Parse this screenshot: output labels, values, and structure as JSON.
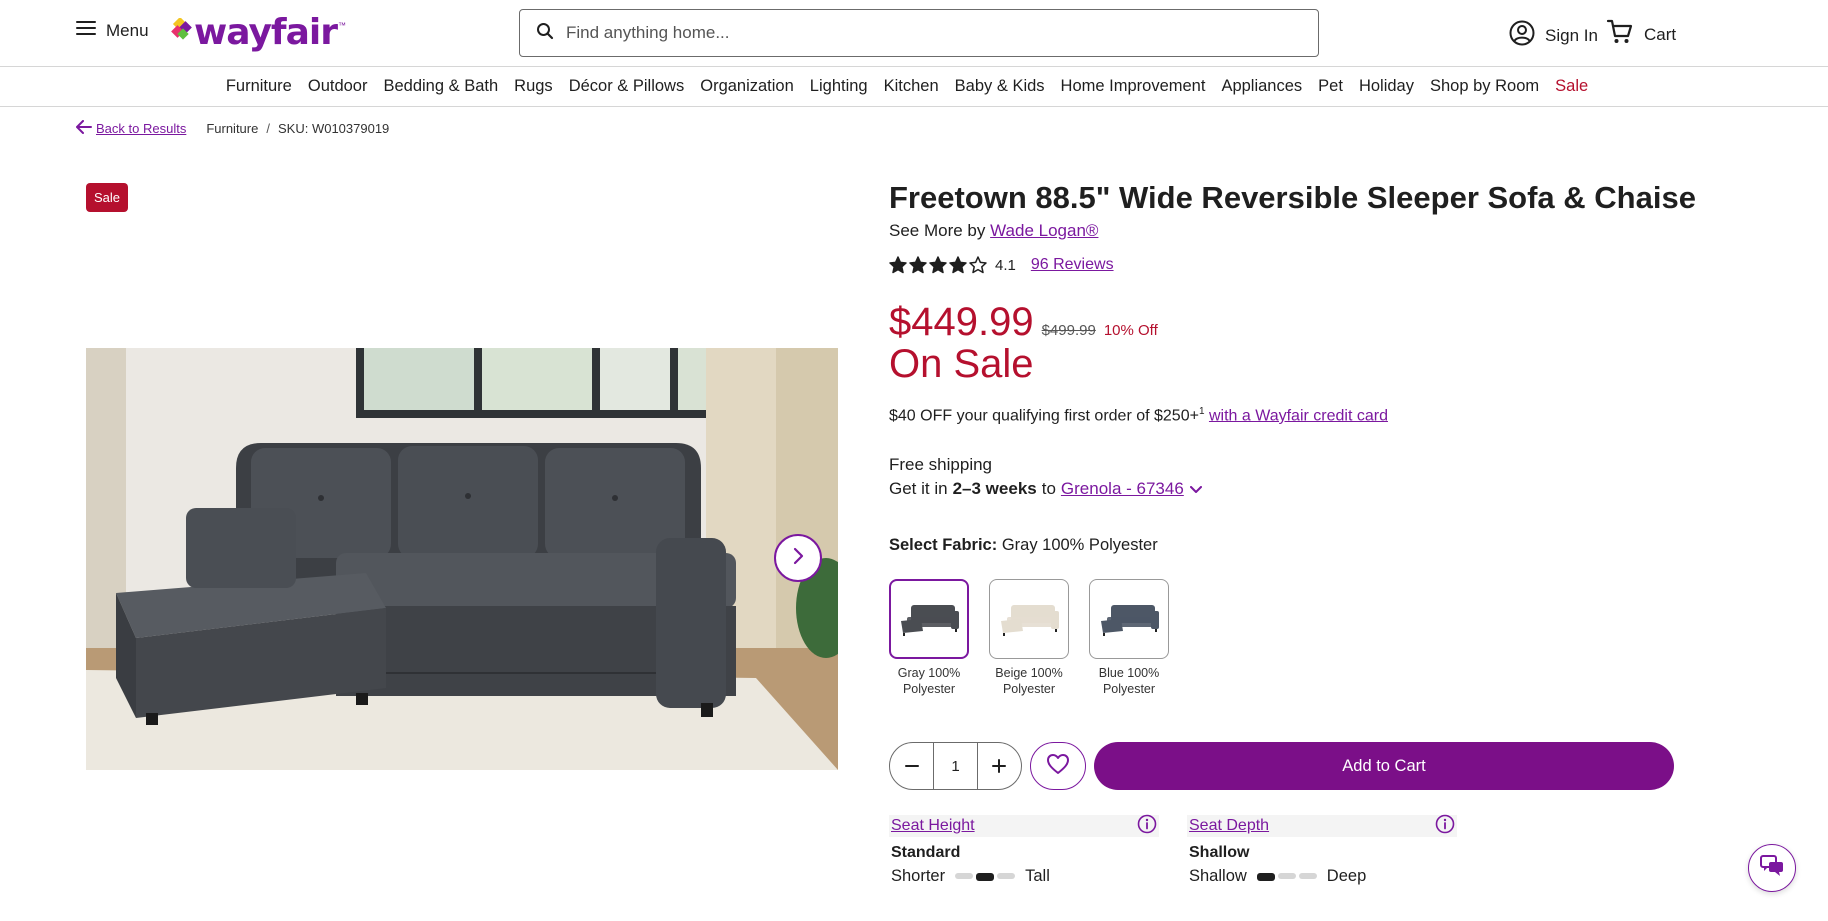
{
  "header": {
    "menu_label": "Menu",
    "logo_text": "wayfair",
    "search_placeholder": "Find anything home...",
    "signin_label": "Sign In",
    "cart_label": "Cart"
  },
  "nav": {
    "items": [
      "Furniture",
      "Outdoor",
      "Bedding & Bath",
      "Rugs",
      "Décor & Pillows",
      "Organization",
      "Lighting",
      "Kitchen",
      "Baby & Kids",
      "Home Improvement",
      "Appliances",
      "Pet",
      "Holiday",
      "Shop by Room",
      "Sale"
    ]
  },
  "breadcrumb": {
    "back_label": "Back to Results",
    "category": "Furniture",
    "separator": "/",
    "sku": "SKU: W010379019"
  },
  "gallery": {
    "badge": "Sale"
  },
  "product": {
    "title": "Freetown 88.5\" Wide Reversible Sleeper Sofa & Chaise",
    "see_more_prefix": "See More by",
    "brand": "Wade Logan®",
    "rating": "4.1",
    "rating_value": 4.1,
    "rating_max": 5,
    "reviews_label": "96 Reviews",
    "price": "$449.99",
    "was_price": "$499.99",
    "discount": "10% Off",
    "sale_label": "On Sale",
    "promo_text": "$40 OFF your qualifying first order of $250+",
    "promo_sup": "1",
    "promo_link": "with a Wayfair credit card",
    "shipping": "Free shipping",
    "delivery_prefix": "Get it in",
    "delivery_time": "2–3 weeks",
    "delivery_to": "to",
    "delivery_location": "Grenola - 67346"
  },
  "fabric": {
    "label": "Select Fabric:",
    "selected": "Gray 100% Polyester",
    "options": [
      {
        "line1": "Gray 100%",
        "line2": "Polyester",
        "color": "#4a4d52"
      },
      {
        "line1": "Beige 100%",
        "line2": "Polyester",
        "color": "#e4ddd0"
      },
      {
        "line1": "Blue 100%",
        "line2": "Polyester",
        "color": "#4d5766"
      }
    ]
  },
  "cart": {
    "quantity": "1",
    "add_label": "Add to Cart"
  },
  "specs": [
    {
      "name": "Seat Height",
      "value": "Standard",
      "low": "Shorter",
      "high": "Tall",
      "level": 2,
      "levels": 3
    },
    {
      "name": "Seat Depth",
      "value": "Shallow",
      "low": "Shallow",
      "high": "Deep",
      "level": 1,
      "levels": 3
    }
  ],
  "colors": {
    "brand_purple": "#7b189f",
    "sale_red": "#b5102e",
    "button_purple": "#7b0f88"
  }
}
